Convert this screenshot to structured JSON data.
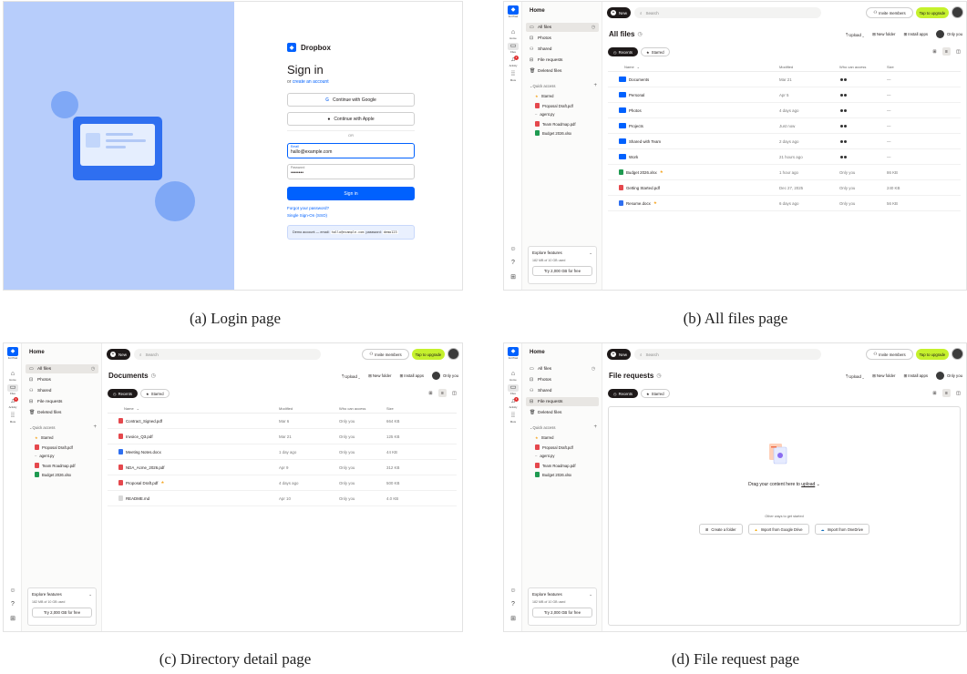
{
  "captions": {
    "a": "(a) Login page",
    "b": "(b) All files page",
    "c": "(c) Directory detail page",
    "d": "(d) File request page"
  },
  "login": {
    "brand": "Dropbox",
    "heading": "Sign in",
    "or_prefix": "or",
    "create_account": "create an account",
    "google": "Continue with Google",
    "apple": "Continue with Apple",
    "divider": "OR",
    "email_label": "Email",
    "email_value": "hallo@example.com",
    "password_label": "Password",
    "password_value": "••••••••",
    "signin_button": "Sign in",
    "forgot": "Forgot your password?",
    "sso": "Single Sign-On (SSO)",
    "demo_prefix": "Demo account — email:",
    "demo_email": "hallo@example.com",
    "demo_mid": "password:",
    "demo_password": "demo123"
  },
  "rail": {
    "logo_label": "For Pixel",
    "home": "Home",
    "files": "Files",
    "activity": "Activity",
    "activity_badge": "1",
    "more": "More"
  },
  "sidebar": {
    "home": "Home",
    "items": [
      "All files",
      "Photos",
      "Shared",
      "File requests",
      "Deleted files"
    ],
    "quick_access": "Quick access",
    "quick": [
      {
        "label": "Starred",
        "kind": "star"
      },
      {
        "label": "Proposal Draft.pdf",
        "kind": "pdf"
      },
      {
        "label": "agent.py",
        "kind": "py"
      },
      {
        "label": "Team Roadmap.pdf",
        "kind": "pdf"
      },
      {
        "label": "Budget 2026.xlsx",
        "kind": "xlsx"
      }
    ],
    "explore_title": "Explore features",
    "storage": "182 MB of 10 GB used",
    "try_button": "Try 2,000 GB for free"
  },
  "topbar": {
    "new": "New",
    "search_placeholder": "Search",
    "invite": "Invite members",
    "upgrade": "Tap to upgrade"
  },
  "actions": {
    "upload": "Upload",
    "new_folder": "New folder",
    "install_apps": "Install apps",
    "only_you": "Only you",
    "recents": "Recents",
    "starred": "Starred"
  },
  "columns": {
    "name": "Name",
    "modified": "Modified",
    "access": "Who can access",
    "size": "Size"
  },
  "all_files": {
    "title": "All files",
    "rows": [
      {
        "name": "Documents",
        "type": "folder",
        "modified": "Mar 21",
        "access": "shared",
        "size": "—",
        "star": false
      },
      {
        "name": "Personal",
        "type": "folder",
        "modified": "Apr 5",
        "access": "shared",
        "size": "—",
        "star": false
      },
      {
        "name": "Photos",
        "type": "folder",
        "modified": "4 days ago",
        "access": "shared",
        "size": "—",
        "star": false
      },
      {
        "name": "Projects",
        "type": "folder",
        "modified": "Just now",
        "access": "shared",
        "size": "—",
        "star": false
      },
      {
        "name": "Shared with Team",
        "type": "folder",
        "modified": "2 days ago",
        "access": "shared",
        "size": "—",
        "star": false
      },
      {
        "name": "Work",
        "type": "folder",
        "modified": "21 hours ago",
        "access": "shared",
        "size": "—",
        "star": false
      },
      {
        "name": "Budget 2026.xlsx",
        "type": "xlsx",
        "modified": "1 hour ago",
        "access": "Only you",
        "size": "86 KB",
        "star": true
      },
      {
        "name": "Getting Started.pdf",
        "type": "pdf",
        "modified": "Dec 27, 2025",
        "access": "Only you",
        "size": "240 KB",
        "star": false
      },
      {
        "name": "Resume.docx",
        "type": "docx",
        "modified": "6 days ago",
        "access": "Only you",
        "size": "56 KB",
        "star": true
      }
    ]
  },
  "documents": {
    "title": "Documents",
    "rows": [
      {
        "name": "Contract_Signed.pdf",
        "type": "pdf",
        "modified": "Mar 6",
        "access": "Only you",
        "size": "664 KB",
        "star": false
      },
      {
        "name": "Invoice_Q3.pdf",
        "type": "pdf",
        "modified": "Mar 21",
        "access": "Only you",
        "size": "125 KB",
        "star": false
      },
      {
        "name": "Meeting Notes.docx",
        "type": "docx",
        "modified": "1 day ago",
        "access": "Only you",
        "size": "44 KB",
        "star": false
      },
      {
        "name": "NDA_Acme_2026.pdf",
        "type": "pdf",
        "modified": "Apr 9",
        "access": "Only you",
        "size": "312 KB",
        "star": false
      },
      {
        "name": "Proposal Draft.pdf",
        "type": "pdf",
        "modified": "4 days ago",
        "access": "Only you",
        "size": "500 KB",
        "star": true
      },
      {
        "name": "README.md",
        "type": "md",
        "modified": "Apr 10",
        "access": "Only you",
        "size": "4.0 KB",
        "star": false
      }
    ]
  },
  "file_requests": {
    "title": "File requests",
    "drag_prefix": "Drag your content here to",
    "drag_link": "upload",
    "other_ways": "Other ways to get started",
    "create_folder": "Create a folder",
    "import_gdrive": "Import from Google Drive",
    "import_onedrive": "Import from OneDrive"
  },
  "colors": {
    "accent": "#0061fe",
    "upgrade": "#c5f12d",
    "login_panel": "#b7cdfb"
  }
}
